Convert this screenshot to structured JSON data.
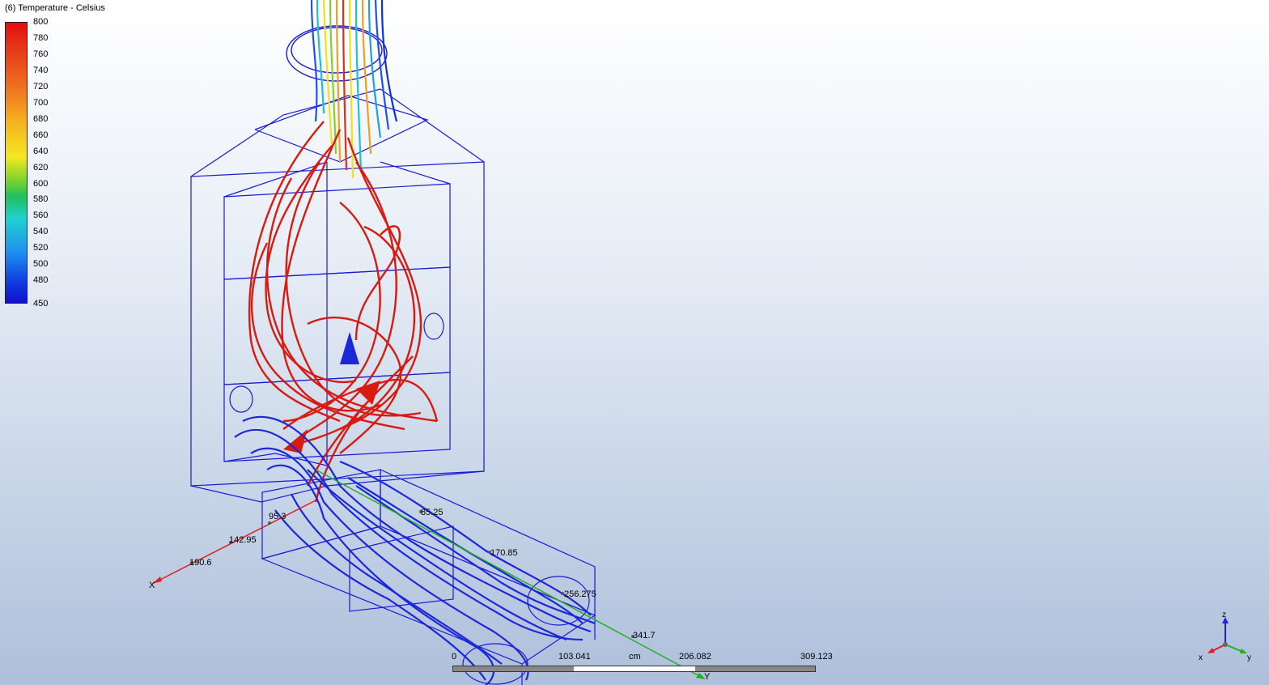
{
  "legend": {
    "title": "(6) Temperature - Celsius",
    "ticks": [
      "800",
      "780",
      "760",
      "740",
      "720",
      "700",
      "680",
      "660",
      "640",
      "620",
      "600",
      "580",
      "560",
      "540",
      "520",
      "500",
      "480",
      "450"
    ]
  },
  "axes": {
    "x_name": "X",
    "x_ticks": [
      "95.3",
      "142.95",
      "190.6"
    ],
    "y_name": "Y",
    "y_ticks": [
      "85.25",
      "170.85",
      "256.275",
      "341.7"
    ],
    "colors": {
      "x": "#e02020",
      "y": "#20b020",
      "z": "#2020e0"
    }
  },
  "scale_bar": {
    "unit": "cm",
    "ticks": [
      "0",
      "103.041",
      "206.082",
      "309.123"
    ]
  },
  "triad": {
    "x": "x",
    "y": "y",
    "z": "z"
  }
}
